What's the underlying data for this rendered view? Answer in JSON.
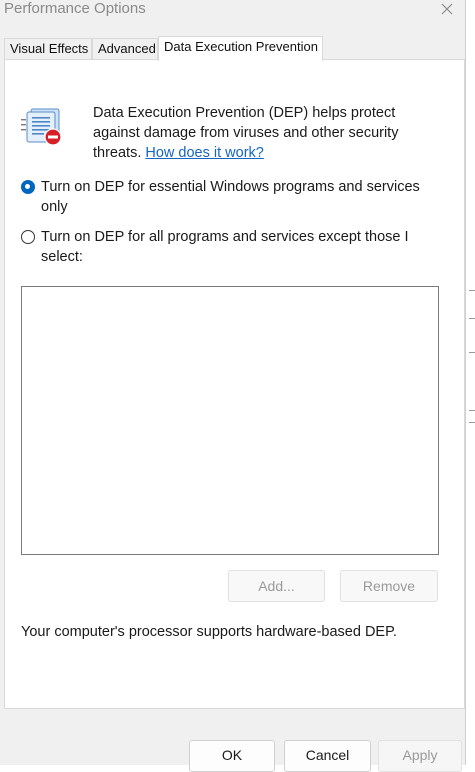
{
  "window": {
    "title": "Performance Options"
  },
  "tabs": [
    {
      "label": "Visual Effects"
    },
    {
      "label": "Advanced"
    },
    {
      "label": "Data Execution Prevention",
      "active": true
    }
  ],
  "dep": {
    "icon": "dep-shield-icon",
    "description": "Data Execution Prevention (DEP) helps protect against damage from viruses and other security threats.",
    "link": "How does it work?",
    "options": [
      {
        "label": "Turn on DEP for essential Windows programs and services only",
        "checked": true
      },
      {
        "label": "Turn on DEP for all programs and services except those I select:",
        "checked": false
      }
    ],
    "add_label": "Add...",
    "remove_label": "Remove",
    "status": "Your computer's processor supports hardware-based DEP."
  },
  "footer": {
    "ok_label": "OK",
    "cancel_label": "Cancel",
    "apply_label": "Apply"
  },
  "colors": {
    "accent": "#0067c0",
    "link": "#1565c0"
  }
}
